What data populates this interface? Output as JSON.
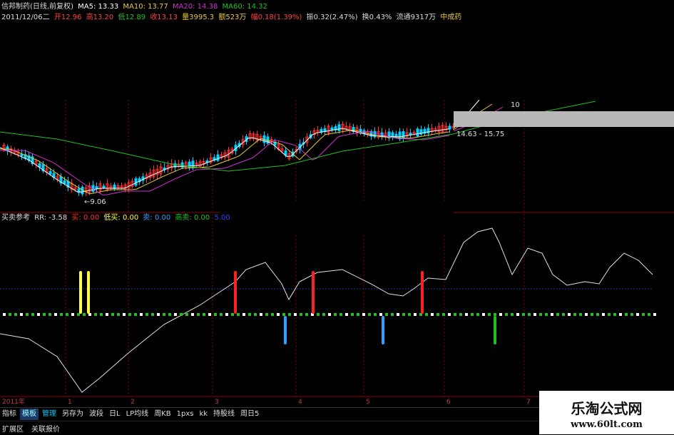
{
  "price_header": {
    "title": "信邦制药(日线,前复权)",
    "ma5": "MA5: 13.33",
    "ma10": "MA10: 13.77",
    "ma20": "MA20: 14.38",
    "ma60": "MA60: 14.32",
    "date": "2011/12/06二",
    "open": "开12.96",
    "high": "高13.20",
    "low": "低12.89",
    "close": "收13.13",
    "volume": "量3995.3",
    "amount": "额523万",
    "change": "幅0.18(1.39%)",
    "amplitude": "振0.32(2.47%)",
    "turnover": "换0.43%",
    "float": "流通9317万",
    "sector": "中成药"
  },
  "price_labels": {
    "low_marker": "←9.06",
    "range_marker": "14.63 - 15.75",
    "hi_marker": "10"
  },
  "indicator_header": {
    "name": "买卖参考",
    "rr": "RR: -3.58",
    "buy": "买: 0.00",
    "low_buy": "低买: 0.00",
    "sell": "卖: 0.00",
    "high_sell": "高卖: 0.00",
    "blue_val": "5.00"
  },
  "time_axis": {
    "labels": [
      "2011年",
      "1",
      "2",
      "3",
      "4",
      "5",
      "6",
      "7"
    ]
  },
  "tabs": [
    {
      "label": "指标"
    },
    {
      "label": "模板"
    },
    {
      "label": "管理"
    },
    {
      "label": "另存为"
    },
    {
      "label": "波段"
    },
    {
      "label": "日L"
    },
    {
      "label": "LP均线"
    },
    {
      "label": "周KB"
    },
    {
      "label": "1pxs"
    },
    {
      "label": "kk"
    },
    {
      "label": "持股线"
    },
    {
      "label": "周日5"
    }
  ],
  "bottom": {
    "expand": "扩展区",
    "related": "关联报价"
  },
  "watermark": {
    "line1": "乐淘公式网",
    "line2": "www.60lt.com"
  },
  "colors": {
    "ma5": "#ffffff",
    "ma10": "#e8c840",
    "ma20": "#d030d0",
    "ma60": "#20c020",
    "up": "#ff3030",
    "down": "#00d0ff",
    "grid": "#8b0000",
    "buy_bar": "#ff2020",
    "low_buy_bar": "#ffff40",
    "sell_bar": "#30a0ff",
    "high_sell_bar": "#20c020"
  }
}
